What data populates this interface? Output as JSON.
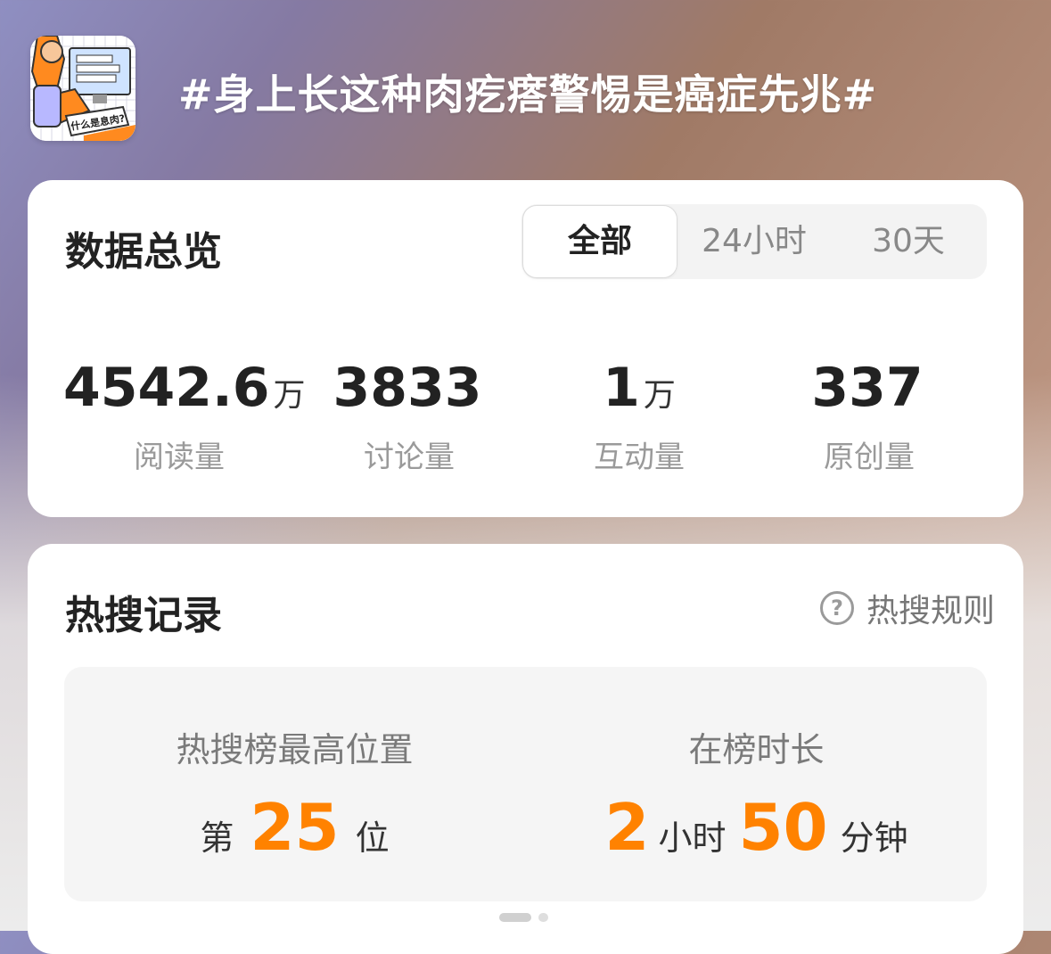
{
  "topic": {
    "title": "#身上长这种肉疙瘩警惕是癌症先兆#",
    "thumbnail_icon": "topic-cover-illustration",
    "thumbnail_caption": "什么是息肉?"
  },
  "overview": {
    "title": "数据总览",
    "tabs": [
      {
        "label": "全部",
        "active": true
      },
      {
        "label": "24小时",
        "active": false
      },
      {
        "label": "30天",
        "active": false
      }
    ],
    "stats": [
      {
        "value": "4542.6",
        "unit": "万",
        "label": "阅读量"
      },
      {
        "value": "3833",
        "unit": "",
        "label": "讨论量"
      },
      {
        "value": "1",
        "unit": "万",
        "label": "互动量"
      },
      {
        "value": "337",
        "unit": "",
        "label": "原创量"
      }
    ]
  },
  "hot_search": {
    "title": "热搜记录",
    "rules_label": "热搜规则",
    "rules_icon": "question-circle-icon",
    "peak": {
      "label": "热搜榜最高位置",
      "prefix": "第",
      "value": "25",
      "suffix": "位"
    },
    "duration": {
      "label": "在榜时长",
      "hours": "2",
      "hours_unit": "小时",
      "minutes": "50",
      "minutes_unit": "分钟"
    }
  },
  "pager": {
    "active_index": 0,
    "count": 2
  },
  "colors": {
    "accent": "#ff8200",
    "card": "#ffffff",
    "muted_text": "#9a9a9a"
  }
}
